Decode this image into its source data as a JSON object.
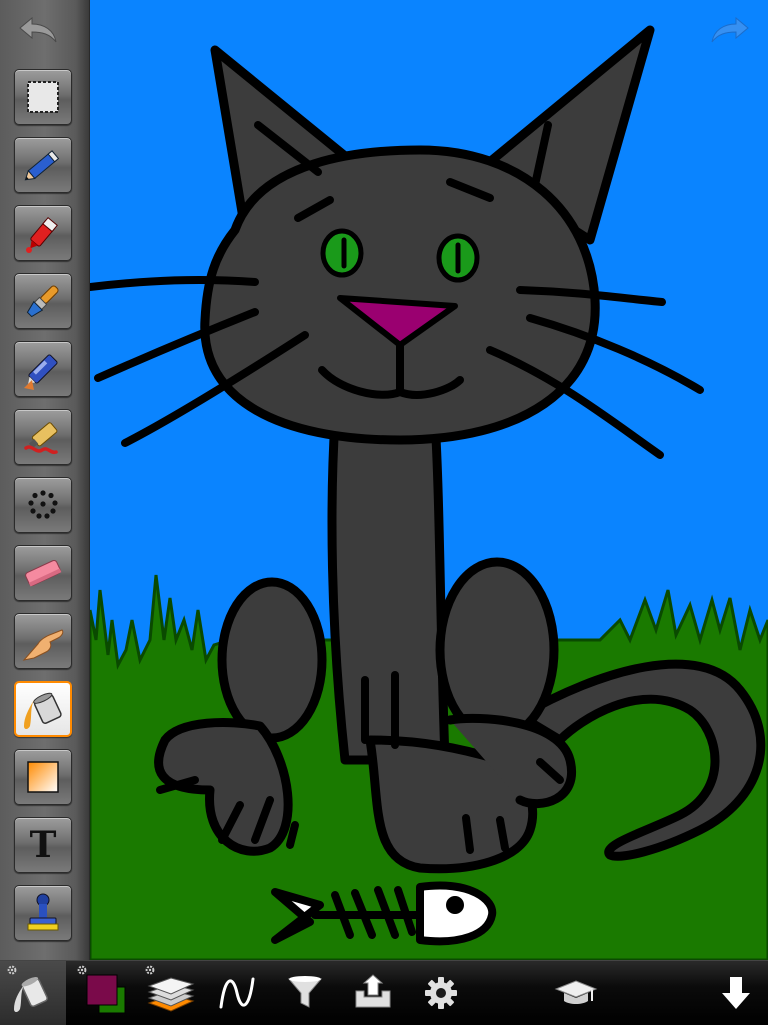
{
  "app": {
    "accent_color": "#ff8a00",
    "toolbar_color": "#6a6a6a",
    "canvas_sky_color": "#0a84ff",
    "canvas_grass_color": "#1a7a00",
    "cat_color": "#3c3c3c"
  },
  "toolbar": {
    "undo_icon": "undo-arrow-icon",
    "redo_icon": "redo-arrow-icon",
    "tools": [
      {
        "name": "selection",
        "icon": "dashed-selection-icon",
        "selected": false
      },
      {
        "name": "pencil",
        "icon": "pencil-icon",
        "selected": false
      },
      {
        "name": "marker",
        "icon": "marker-icon",
        "selected": false
      },
      {
        "name": "paintbrush",
        "icon": "paintbrush-icon",
        "selected": false
      },
      {
        "name": "airbrush",
        "icon": "airbrush-icon",
        "selected": false
      },
      {
        "name": "paint-tube",
        "icon": "paint-tube-icon",
        "selected": false
      },
      {
        "name": "spray",
        "icon": "dot-circle-icon",
        "selected": false
      },
      {
        "name": "eraser",
        "icon": "eraser-icon",
        "selected": false
      },
      {
        "name": "smudge",
        "icon": "finger-icon",
        "selected": false
      },
      {
        "name": "fill",
        "icon": "paint-bucket-icon",
        "selected": true
      },
      {
        "name": "gradient",
        "icon": "gradient-icon",
        "selected": false
      },
      {
        "name": "text",
        "icon": "text-icon",
        "selected": false
      },
      {
        "name": "stamp",
        "icon": "stamp-icon",
        "selected": false
      }
    ],
    "text_tool_label": "T"
  },
  "bottom_bar": {
    "items": [
      {
        "name": "fill-tool-options",
        "icon": "paint-bucket-icon",
        "active": true
      },
      {
        "name": "color-swatch",
        "primary_color": "#7a0a4a",
        "secondary_color": "#1a7a00"
      },
      {
        "name": "layers",
        "icon": "layers-icon"
      },
      {
        "name": "brush-curve",
        "icon": "curve-icon"
      },
      {
        "name": "filters",
        "icon": "funnel-icon"
      },
      {
        "name": "import-export",
        "icon": "tray-arrow-icon"
      },
      {
        "name": "settings",
        "icon": "gear-icon"
      },
      {
        "name": "tutorials",
        "icon": "graduation-cap-icon"
      },
      {
        "name": "hide-toolbar",
        "icon": "down-arrow-icon"
      }
    ]
  }
}
